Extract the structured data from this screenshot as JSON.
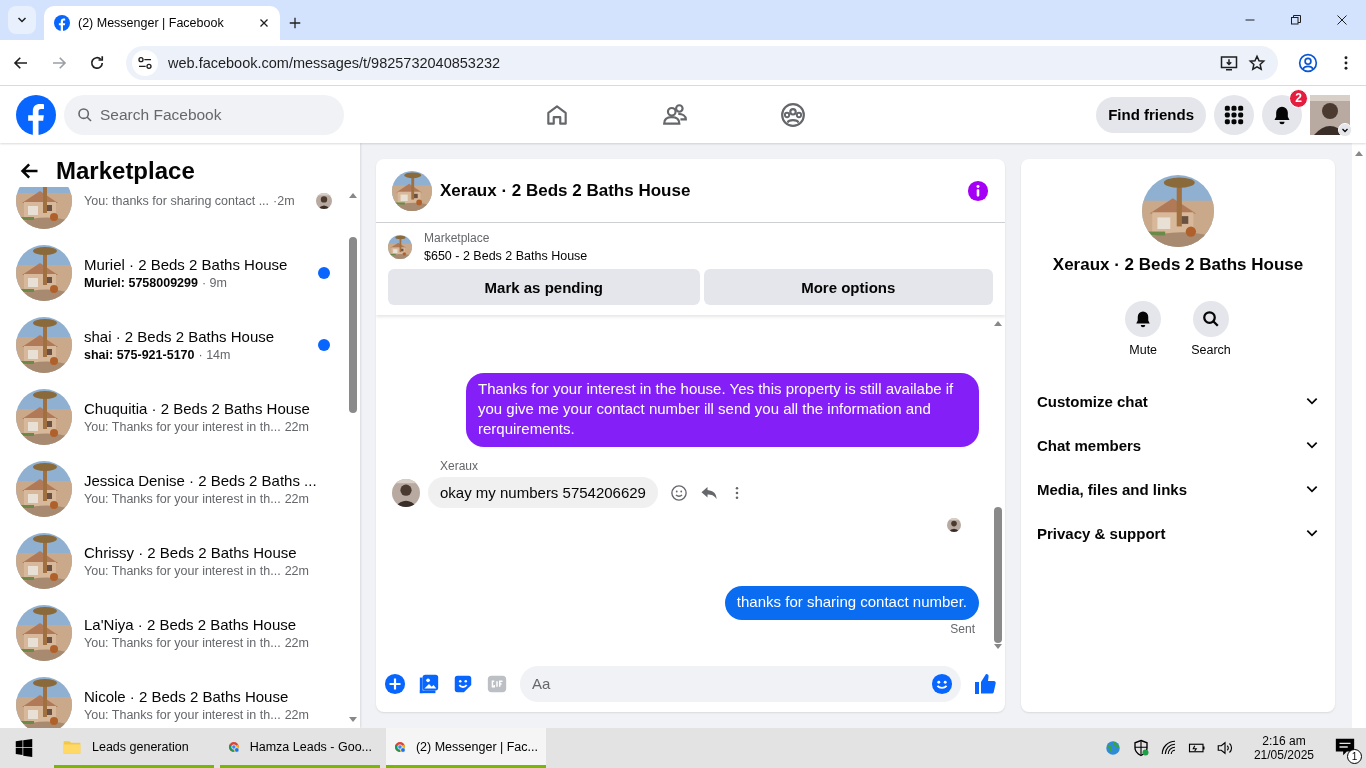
{
  "browser": {
    "tab": {
      "title": "(2) Messenger | Facebook",
      "selected": true
    },
    "url": "web.facebook.com/messages/t/9825732040853232"
  },
  "header": {
    "search": {
      "placeholder": "Search Facebook"
    },
    "find_friends": "Find friends",
    "notification_count": "2"
  },
  "sidebar": {
    "title": "Marketplace",
    "conversations": [
      {
        "preview": "You: thanks for sharing contact ...",
        "time": "·2m",
        "unread": false,
        "seen": true
      },
      {
        "title": "Muriel · 2 Beds 2 Baths House",
        "preview": "Muriel: 5758009299",
        "time": "· 9m",
        "unread": true,
        "seen": false
      },
      {
        "title": "shai · 2 Beds 2 Baths House",
        "preview": "shai: 575-921-5170",
        "time": "· 14m",
        "unread": true,
        "seen": false
      },
      {
        "title": "Chuquitia · 2 Beds 2 Baths House",
        "preview": "You: Thanks for your interest in th...",
        "time": "22m",
        "unread": false,
        "seen": false
      },
      {
        "title": "Jessica Denise · 2 Beds 2 Baths ...",
        "preview": "You: Thanks for your interest in th...",
        "time": "22m",
        "unread": false,
        "seen": false
      },
      {
        "title": "Chrissy · 2 Beds 2 Baths House",
        "preview": "You: Thanks for your interest in th...",
        "time": "22m",
        "unread": false,
        "seen": false
      },
      {
        "title": "La'Niya · 2 Beds 2 Baths House",
        "preview": "You: Thanks for your interest in th...",
        "time": "22m",
        "unread": false,
        "seen": false
      },
      {
        "title": "Nicole · 2 Beds 2 Baths House",
        "preview": "You: Thanks for your interest in th...",
        "time": "22m",
        "unread": false,
        "seen": false
      }
    ]
  },
  "chat": {
    "title": "Xeraux · 2 Beds 2 Baths House",
    "listing": {
      "source": "Marketplace",
      "price_title": "$650 - 2 Beds 2 Baths House"
    },
    "buttons": [
      "Mark as pending",
      "More options"
    ],
    "messages": [
      {
        "kind": "outgoing",
        "text": "Thanks for your interest in the house. Yes this property is still availabe if you give me your contact number ill send you all the information and rerquirements.",
        "color": "#8420f7"
      },
      {
        "kind": "incoming",
        "sender": "Xeraux",
        "text": "okay my numbers 5754206629"
      },
      {
        "kind": "seen"
      },
      {
        "kind": "outgoing",
        "text": "thanks for sharing contact number.",
        "color": "#0a6cf0",
        "status": "Sent"
      }
    ],
    "composer": {
      "placeholder": "Aa"
    }
  },
  "info_panel": {
    "title": "Xeraux · 2 Beds 2 Baths House",
    "actions": [
      "Mute",
      "Search"
    ],
    "sections": [
      {
        "label": "Customize chat",
        "expanded": false
      },
      {
        "label": "Chat members",
        "expanded": false
      },
      {
        "label": "Media, files and links",
        "expanded": false
      },
      {
        "label": "Privacy & support",
        "expanded": false
      }
    ]
  },
  "taskbar": {
    "apps": [
      {
        "kind": "folder",
        "label": "Leads generation",
        "selected": false
      },
      {
        "kind": "browser",
        "label": "Hamza Leads - Goo...",
        "selected": false
      },
      {
        "kind": "browser",
        "label": "(2) Messenger | Fac...",
        "selected": true
      }
    ],
    "time": "2:16 am",
    "date": "21/05/2025",
    "notifications": "1"
  }
}
